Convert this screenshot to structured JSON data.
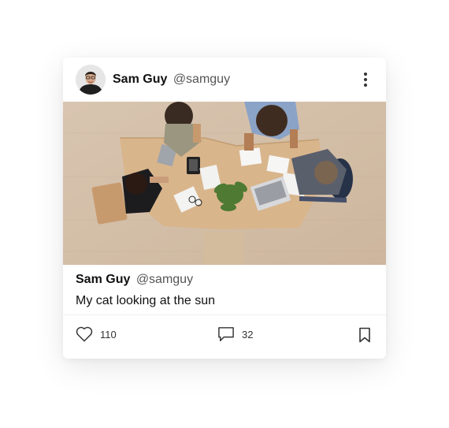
{
  "post": {
    "author_name": "Sam Guy",
    "author_handle": "@samguy",
    "caption": "My cat looking at the sun",
    "likes": "110",
    "comments": "32"
  },
  "icons": {
    "menu": "more-vertical-icon",
    "like": "heart-icon",
    "comment": "comment-icon",
    "bookmark": "bookmark-icon"
  },
  "colors": {
    "text": "#111111",
    "handle": "#555555",
    "icon": "#333333"
  }
}
